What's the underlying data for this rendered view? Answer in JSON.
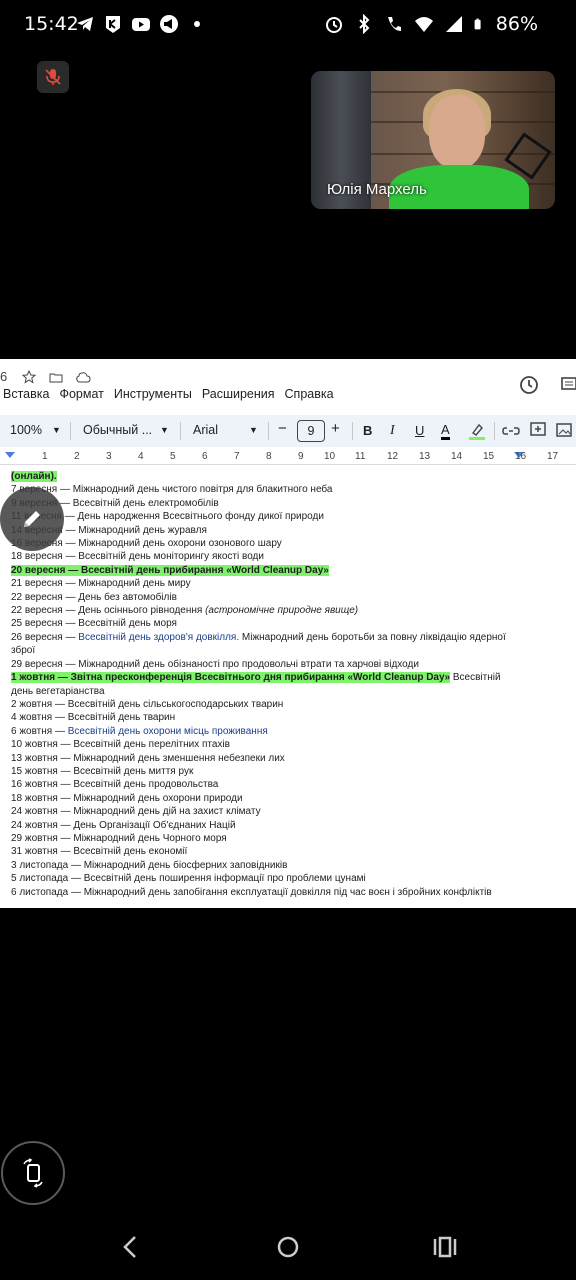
{
  "status_bar": {
    "time": "15:42",
    "battery": "86%",
    "left_icons": [
      "telegram-icon",
      "kyivstar-icon",
      "youtube-icon",
      "megaphone-icon",
      "dot-icon"
    ],
    "right_icons": [
      "alarm-icon",
      "bluetooth-icon",
      "wifi-call-icon",
      "wifi-icon",
      "signal-icon",
      "battery-icon"
    ]
  },
  "call": {
    "participant_name": "Юлія Мархель",
    "mic_state_icon": "mic-off-icon"
  },
  "doc": {
    "menu": [
      "Вставка",
      "Формат",
      "Инструменты",
      "Расширения",
      "Справка"
    ],
    "toolbar": {
      "zoom": "100%",
      "style": "Обычный ...",
      "font": "Arial",
      "font_size": "9"
    },
    "ruler": [
      "1",
      "2",
      "3",
      "4",
      "5",
      "6",
      "7",
      "8",
      "9",
      "10",
      "11",
      "12",
      "13",
      "14",
      "15",
      "16",
      "17"
    ],
    "lines": [
      {
        "text": "(онлайн).",
        "style": "hl"
      },
      {
        "text": "7 вересня — Міжнародний день чистого повітря для блакитного неба"
      },
      {
        "text": "9 вересня — Всесвітній день електромобілів"
      },
      {
        "text": "11 вересня — День народження Всесвітнього фонду дикої природи"
      },
      {
        "text": "14 вересня — Міжнародний день журавля"
      },
      {
        "text": "16 вересня — Міжнародний день охорони озонового шару"
      },
      {
        "text": "18 вересня — Всесвітній день моніторингу якості води"
      },
      {
        "text": "20 вересня — Всесвітній день прибирання «World Cleanup Day»",
        "style": "hl"
      },
      {
        "text": "21 вересня — Міжнародний день миру"
      },
      {
        "text": "22 вересня — День без автомобілів"
      },
      {
        "text": "22 вересня — День осіннього рівнодення",
        "extra": "(астрономічне природне явище)"
      },
      {
        "text": "25 вересня — Всесвітній день моря"
      },
      {
        "text": "26 вересня — ",
        "blue": "Всесвітній день здоров'я довкілля.",
        "rest": " Міжнародний день боротьби за повну ліквідацію ядерної"
      },
      {
        "text": "зброї"
      },
      {
        "text": "29 вересня — Міжнародний день обізнаності про продовольчі втрати та харчові відходи"
      },
      {
        "text": "1 жовтня — Звітна пресконференція Всесвітнього дня прибирання «World Cleanup Day»",
        "style": "hl",
        "rest": " Всесвітній"
      },
      {
        "text": "день вегетаріанства"
      },
      {
        "text": "2 жовтня — Всесвітній день сільськогосподарських тварин"
      },
      {
        "text": "4 жовтня — Всесвітній день тварин"
      },
      {
        "text": "6 жовтня — ",
        "blue": "Всесвітній день охорони місць проживання"
      },
      {
        "text": "10 жовтня — Всесвітній день перелітних птахів"
      },
      {
        "text": "13 жовтня — Міжнародний день зменшення небезпеки лих"
      },
      {
        "text": "15 жовтня — Всесвітній день миття рук"
      },
      {
        "text": "16 жовтня — Всесвітній день продовольства"
      },
      {
        "text": "18 жовтня — Міжнародний день охорони природи"
      },
      {
        "text": "24 жовтня — Міжнародний день дій на захист клімату"
      },
      {
        "text": "24 жовтня — День Організації Об'єднаних Націй"
      },
      {
        "text": "29 жовтня — Міжнародний день Чорного моря"
      },
      {
        "text": "31 жовтня — Всесвітній день економії"
      },
      {
        "text": "3 листопада — Міжнародний день біосферних заповідників"
      },
      {
        "text": "5 листопада — Всесвітній день поширення інформації про проблеми цунамі"
      },
      {
        "text": "6 листопада — Міжнародний день запобігання експлуатації довкілля під час воєн і збройних конфліктів"
      }
    ]
  },
  "colors": {
    "highlight": "#7ef26a",
    "background": "#000000",
    "doc_bg": "#ffffff",
    "toolbar_bg": "#eef2f9"
  }
}
